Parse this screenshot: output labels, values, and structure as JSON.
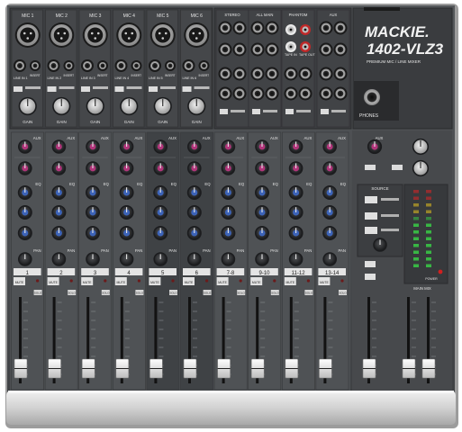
{
  "brand": {
    "name": "MACKIE.",
    "model": "1402-VLZ3",
    "tagline": "PREMIUM MIC / LINE MIXER"
  },
  "colors": {
    "chassis": "#4a4c4f",
    "chassis_dark": "#2e3032",
    "panel_light": "#dcdcdc",
    "aux_knob": "#b0357a",
    "eq_knob": "#3c63b8",
    "green_led": "#39c445",
    "red_led": "#e02525",
    "yellow_led": "#e8c21d"
  },
  "mic_inputs": {
    "labels": [
      "MIC 1",
      "MIC 2",
      "MIC 3",
      "MIC 4",
      "MIC 5",
      "MIC 6"
    ]
  },
  "line_inputs": {
    "labels": [
      "LINE IN 1",
      "LINE IN 2",
      "LINE IN 3",
      "LINE IN 4",
      "LINE IN 5",
      "LINE IN 6"
    ],
    "insert_labels": [
      "INSERT",
      "INSERT",
      "INSERT",
      "INSERT",
      "INSERT",
      "INSERT"
    ],
    "gain_labels": [
      "GAIN",
      "GAIN",
      "GAIN",
      "GAIN",
      "GAIN",
      "GAIN"
    ]
  },
  "stereo_inputs": {
    "headers": [
      "STEREO",
      "ALL MAIN",
      "PHANTOM",
      "AUX"
    ],
    "tape_labels": [
      "TAPE IN",
      "TAPE OUT"
    ],
    "phones_label": "PHONES"
  },
  "channel_strips": {
    "aux_label": "AUX",
    "eq_label": "EQ",
    "pan_label": "PAN",
    "mute_label": "MUTE",
    "solo_label": "SOLO",
    "numbers": [
      "1",
      "2",
      "3",
      "4",
      "5",
      "6",
      "7-8",
      "9-10",
      "11-12",
      "13-14"
    ]
  },
  "master_section": {
    "aux_master_label": "AUX",
    "source_label": "SOURCE",
    "main_mix_label": "MAIN MIX",
    "power_label": "POWER"
  }
}
